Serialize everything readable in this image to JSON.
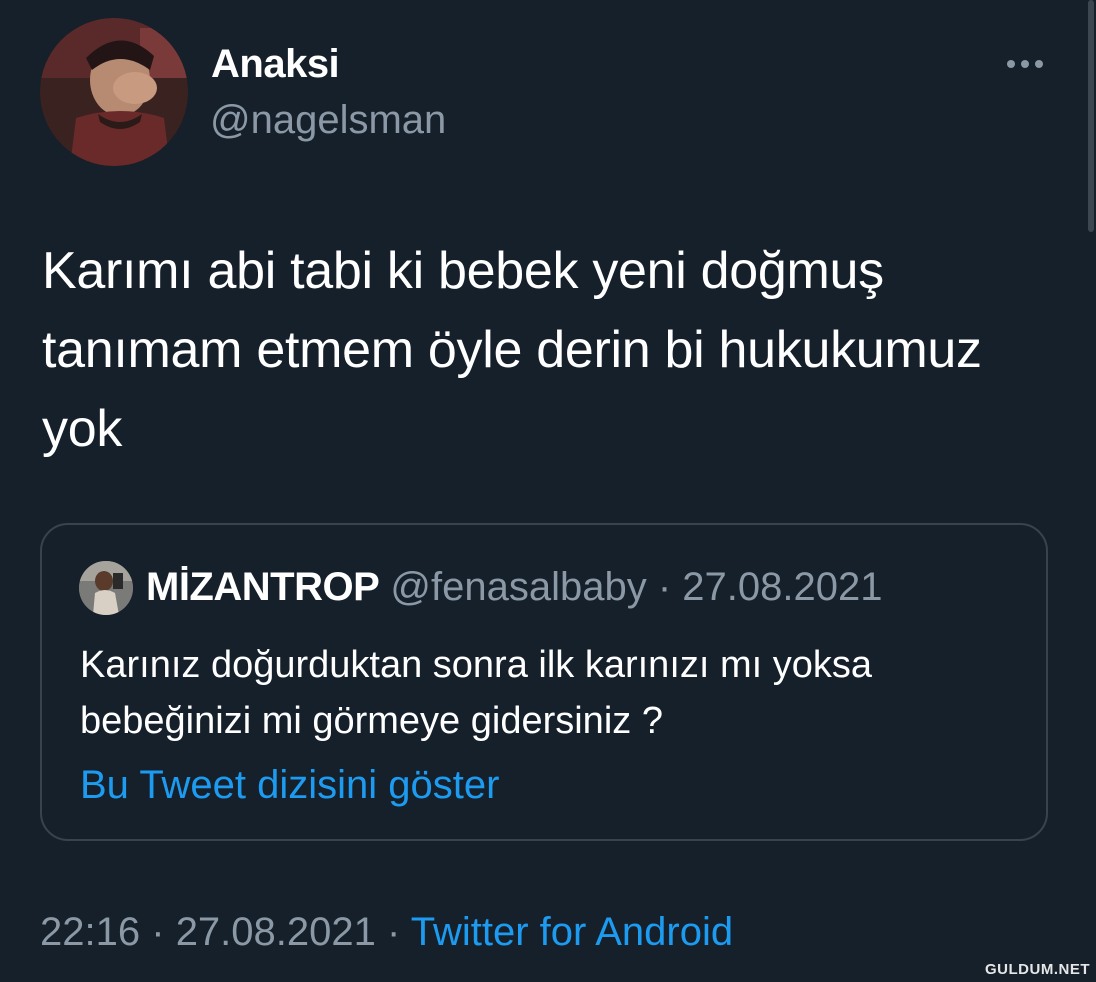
{
  "author": {
    "display_name": "Anaksi",
    "handle": "@nagelsman"
  },
  "tweet": {
    "text": "Karımı abi tabi ki bebek yeni doğmuş tanımam etmem öyle derin bi hukukumuz yok"
  },
  "quoted_tweet": {
    "display_name": "MİZANTROP",
    "handle": "@fenasalbaby",
    "separator": "·",
    "date": "27.08.2021",
    "text": "Karınız doğurduktan sonra ilk karınızı mı yoksa bebeğinizi mi görmeye gidersiniz ?",
    "thread_link": "Bu Tweet dizisini göster"
  },
  "meta": {
    "time": "22:16",
    "separator_1": "·",
    "date": "27.08.2021",
    "separator_2": "·",
    "source": "Twitter for Android"
  },
  "watermark": "GULDUM.NET",
  "colors": {
    "background": "#15202b",
    "primary_text": "#ffffff",
    "secondary_text": "#8b98a5",
    "link": "#1d9bf0",
    "border": "#38444d"
  },
  "icons": {
    "more": "more-horizontal-icon"
  }
}
